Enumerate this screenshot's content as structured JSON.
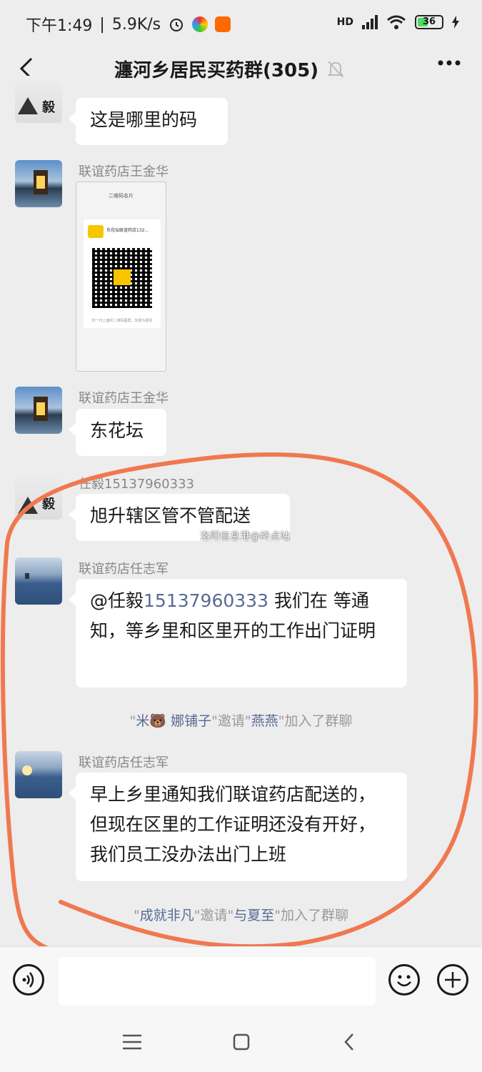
{
  "status": {
    "time": "下午1:49",
    "speed": "5.9K/s",
    "network": "HD",
    "battery": "36"
  },
  "header": {
    "title": "瀍河乡居民买药群(305)"
  },
  "messages": [
    {
      "text": "这是哪里的码"
    },
    {
      "sender": "联谊药店王金华",
      "qr_title": "二维码名片",
      "qr_name": "东花坛联谊药店132...",
      "qr_sub": "扫一扫上面的二维码图案，加我为朋友"
    },
    {
      "sender": "联谊药店王金华",
      "text": "东花坛"
    },
    {
      "sender": "任毅15137960333",
      "text": "旭升辖区管不管配送"
    },
    {
      "sender": "联谊药店任志军",
      "mention": "@任毅",
      "phone": "15137960333",
      "text": " 我们在  等通知，等乡里和区里开的工作出门证明"
    },
    {
      "sender": "联谊药店任志军",
      "text": "早上乡里通知我们联谊药店配送的，但现在区里的工作证明还没有开好，我们员工没办法出门上班"
    }
  ],
  "system": [
    {
      "inviter": "米🐻 娜铺子",
      "invite": "邀请",
      "invitee": "燕燕",
      "joined": "加入了群聊"
    },
    {
      "inviter": "成就非凡",
      "invite": "邀请",
      "invitee": "与夏至",
      "joined": "加入了群聊"
    }
  ],
  "watermark": "洛阳信息港@终点站",
  "avatar_text": "毅",
  "colors": {
    "background": "#ededed",
    "mention": "#576b95",
    "annotation": "#f07850"
  }
}
